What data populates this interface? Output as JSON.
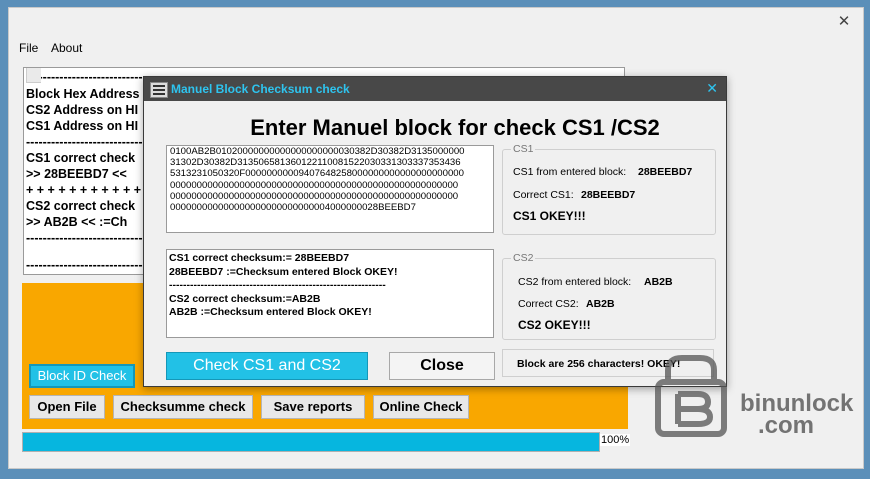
{
  "window": {
    "close_glyph": "✕"
  },
  "menu": {
    "file": "File",
    "about": "About"
  },
  "log_lines": [
    "-----------------------------------------------------------------------",
    "Block Hex Address",
    "CS2 Address on HI",
    "CS1 Address on HI",
    "--------------------------------------",
    "CS1 correct check",
    ">> 28BEEBD7 <<",
    "+ + + + + + + + + + + +",
    "CS2 correct check",
    ">> AB2B << :=Ch",
    "-----------------------------------------------------------------------",
    "------------------------------------------------------------------------"
  ],
  "main_buttons": {
    "block_id_check": "Block ID Check",
    "open_file": "Open File",
    "checksumme_check": "Checksumme check",
    "save_reports": "Save reports",
    "online_check": "Online Check"
  },
  "progress": {
    "value": 1.0,
    "label": "100%"
  },
  "dialog": {
    "title": "Manuel Block Checksum check",
    "close_glyph": "✕",
    "heading": "Enter Manuel block for check CS1 /CS2",
    "hex_lines": [
      "0100AB2B01020000000000000000000030382D30382D3135000000",
      "31302D30382D313506581360122110081522030331303337353436",
      "5313231050320F00000000009407648258000000000000000000000",
      "000000000000000000000000000000000000000000000000000000",
      "000000000000000000000000000000000000000000000000000000",
      "000000000000000000000000000004000000028BEEBD7"
    ],
    "result_lines": [
      "CS1 correct checksum:= 28BEEBD7",
      "28BEEBD7 :=Checksum entered Block OKEY!",
      "--------------------------------------------------------------",
      "CS2 correct checksum:=AB2B",
      "AB2B :=Checksum entered Block OKEY!"
    ],
    "cs1": {
      "legend": "CS1",
      "from_label": "CS1 from entered block:",
      "from_value": "28BEEBD7",
      "correct_label": "Correct CS1:",
      "correct_value": "28BEEBD7",
      "status": "CS1  OKEY!!!"
    },
    "cs2": {
      "legend": "CS2",
      "from_label": "CS2 from entered block:",
      "from_value": "AB2B",
      "correct_label": "Correct CS2:",
      "correct_value": "AB2B",
      "status": "CS2  OKEY!!!"
    },
    "check_button": "Check CS1 and CS2",
    "close_button": "Close",
    "length_status": "Block are 256 characters! OKEY!"
  },
  "watermark": {
    "line1": "binunlock",
    "line2": ".com"
  }
}
